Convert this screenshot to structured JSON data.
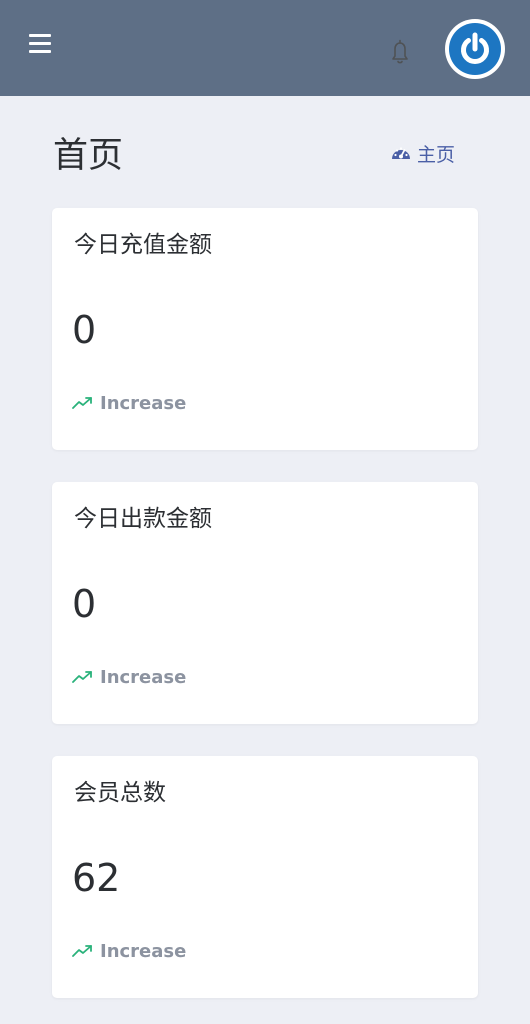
{
  "header": {
    "menu_icon": "hamburger-menu-icon",
    "notification_icon": "bell-icon",
    "avatar_icon": "power-icon"
  },
  "page": {
    "title": "首页",
    "breadcrumb": {
      "icon": "dashboard-gauge-icon",
      "label": "主页"
    }
  },
  "colors": {
    "header_bg": "#5e6f86",
    "page_bg": "#edeff5",
    "accent_blue": "#1d76c2",
    "link": "#4a5fa6",
    "trend_green": "#2ab27b",
    "trend_label": "#8c93a0"
  },
  "stats": [
    {
      "title": "今日充值金额",
      "value": "0",
      "trend": "Increase",
      "trend_icon": "trending-up-icon"
    },
    {
      "title": "今日出款金额",
      "value": "0",
      "trend": "Increase",
      "trend_icon": "trending-up-icon"
    },
    {
      "title": "会员总数",
      "value": "62",
      "trend": "Increase",
      "trend_icon": "trending-up-icon"
    }
  ]
}
